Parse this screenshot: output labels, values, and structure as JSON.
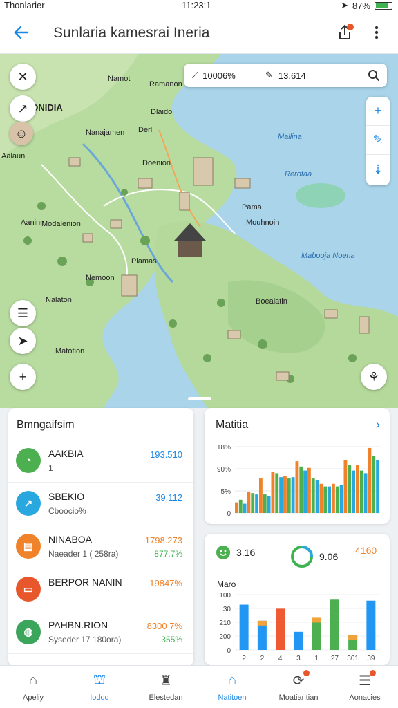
{
  "status_bar": {
    "carrier": "Thonlarier",
    "time": "11:23:1",
    "battery": "87%"
  },
  "app_bar": {
    "title": "Sunlaria kamesrai Ineria"
  },
  "map": {
    "search": {
      "value_a": "10006%",
      "value_b": "13.614"
    },
    "labels": [
      "DNIDIA",
      "Namot",
      "Ramanon",
      "Dlaido",
      "Nanajamen",
      "Derl",
      "Aalaun",
      "Doenion",
      "Aaninn",
      "Modalenion",
      "Pama",
      "Mouhnoin",
      "Plamas",
      "Nemoon",
      "Nalaton",
      "Boealatin",
      "Matotion",
      "Mallina",
      "Rerotaa",
      "Mabooja Noena"
    ]
  },
  "summary_card": {
    "title": "Bmngaifsim",
    "rows": [
      {
        "icon": "pie-chart-icon",
        "color": "#4caf50",
        "name": "AAKBIA",
        "sub": "1",
        "value": "193.510",
        "value2": "",
        "value_color": "#1e88e5"
      },
      {
        "icon": "arrow-up-right-icon",
        "color": "#29a7df",
        "name": "SBEKIO",
        "sub": "Cboocio%",
        "value": "39.112",
        "value2": "",
        "value_color": "#1e88e5"
      },
      {
        "icon": "briefcase-icon",
        "color": "#f0822a",
        "name": "NINABOA",
        "sub": "Naeader 1 ( 258ra)",
        "value": "1798.273",
        "value2": "877.7%",
        "value_color": "#f0822a"
      },
      {
        "icon": "card-icon",
        "color": "#e8572b",
        "name": "BERPOR NANIN",
        "sub": "",
        "value": "19847%",
        "value2": "",
        "value_color": "#f0822a"
      },
      {
        "icon": "globe-icon",
        "color": "#3ba55c",
        "name": "PAHBN.RION",
        "sub": "Syseder 17 180ora)",
        "value": "8300 7%",
        "value2": "355%",
        "value_color": "#f0822a"
      }
    ]
  },
  "metrics_card": {
    "title": "Matitia",
    "ytick_labels": [
      "18%",
      "90%",
      "5%",
      "0"
    ]
  },
  "stats_card": {
    "stat1": "3.16",
    "stat2": "9.06",
    "stat3": "4160",
    "subtitle": "Maro",
    "ytick_labels": [
      "100",
      "30",
      "210",
      "200",
      "0"
    ],
    "xtick_labels": [
      "2",
      "2",
      "4",
      "3",
      "1",
      "27",
      "301",
      "39"
    ]
  },
  "chart_data": [
    {
      "type": "bar",
      "title": "Matitia",
      "ylim": [
        0,
        100
      ],
      "y_ticks": [
        "18%",
        "90%",
        "5%",
        "0"
      ],
      "series": [
        {
          "values": [
            16,
            32,
            52,
            62,
            56,
            78,
            68,
            44,
            44,
            80,
            72,
            98
          ]
        },
        {
          "values": [
            20,
            30,
            28,
            60,
            52,
            70,
            52,
            40,
            40,
            72,
            64,
            86
          ]
        },
        {
          "values": [
            14,
            28,
            26,
            54,
            54,
            64,
            50,
            40,
            42,
            64,
            60,
            80
          ]
        }
      ],
      "colors": [
        "#f0822a",
        "#4caf50",
        "#29a7df"
      ]
    },
    {
      "type": "bar",
      "title": "Maro",
      "ylim": [
        0,
        110
      ],
      "y_ticks": [
        "100",
        "30",
        "210",
        "200",
        "0"
      ],
      "categories": [
        "2",
        "2",
        "4",
        "3",
        "1",
        "27",
        "301",
        "39"
      ],
      "series": [
        {
          "name": "",
          "values": [
            90,
            58,
            82,
            36,
            64,
            100,
            30,
            98
          ]
        }
      ],
      "bar_colors": [
        "#2196f3",
        "#2196f3",
        "#ef5a32",
        "#2196f3",
        "#4caf50",
        "#4caf50",
        "#4caf50",
        "#2196f3"
      ],
      "cap_colors": [
        "",
        "#f0a33a",
        "",
        "",
        "#f0a33a",
        "",
        "#f0a33a",
        ""
      ]
    }
  ],
  "bottom_nav": [
    {
      "label": "Apeliy",
      "glyph": "⌂",
      "active": false,
      "badge": false
    },
    {
      "label": "Iodod",
      "glyph": "⛫",
      "active": true,
      "badge": false
    },
    {
      "label": "Elestedan",
      "glyph": "♜",
      "active": false,
      "badge": false
    },
    {
      "label": "Natitoen",
      "glyph": "⌂",
      "active": true,
      "badge": false
    },
    {
      "label": "Moatiantian",
      "glyph": "⟳",
      "active": false,
      "badge": true
    },
    {
      "label": "Aonacies",
      "glyph": "☰",
      "active": false,
      "badge": true
    }
  ]
}
